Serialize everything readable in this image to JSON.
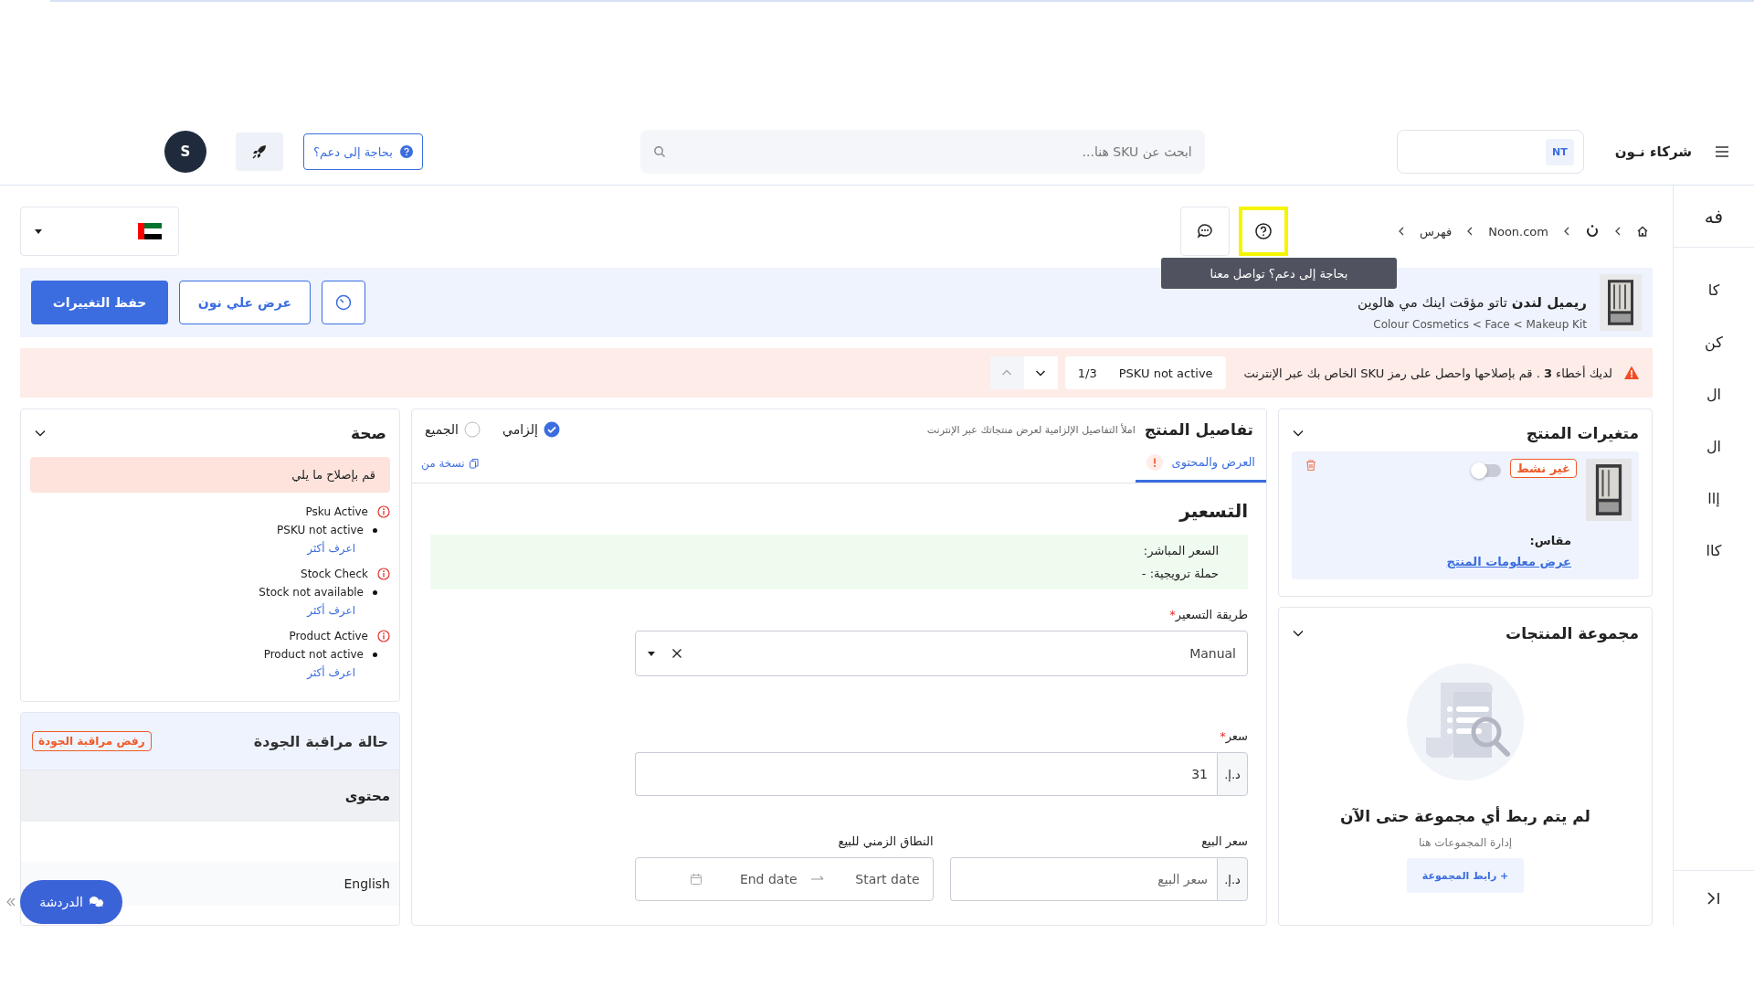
{
  "header": {
    "brand": "شركاء نـون",
    "account_badge": "NT",
    "search": {
      "placeholder": "ابحث عن SKU هنا..."
    },
    "help_button": "بحاجة إلى دعم؟",
    "avatar": "S"
  },
  "side_nav": [
    {
      "label": "فه",
      "kind": "header"
    },
    {
      "label": "كا",
      "kind": "item"
    },
    {
      "label": "كن",
      "kind": "item"
    },
    {
      "label": "ال",
      "kind": "item"
    },
    {
      "label": "ال",
      "kind": "item"
    },
    {
      "label": "إاا",
      "kind": "item"
    },
    {
      "label": "كاا",
      "kind": "item"
    }
  ],
  "breadcrumb": [
    {
      "label": "Noon.com"
    },
    {
      "label": "فهرس"
    }
  ],
  "support_button": {
    "highlighted": true
  },
  "tooltip": "بحاجة إلى دعم؟ تواصل معنا",
  "product": {
    "title": "**ريميل لندن** تاتو مؤقت اينك مي هالوين",
    "category_path": "Colour Cosmetics < Face < Makeup Kit"
  },
  "actions": {
    "save": "حفظ التغييرات",
    "view": "عرض علي نون"
  },
  "errors": {
    "message": "لديك أخطاء **3** . قم بإصلاحها واحصل على رمز SKU الخاص بك عبر الإنترنت",
    "current": "PSKU not active",
    "counter": "1/3",
    "previous_disabled": true
  },
  "variants": {
    "title": "متغيرات المنتج",
    "items": [
      {
        "status": "غير نشط",
        "active": false,
        "size_label": "مقاس:",
        "link": "عرض معلومات المنتج"
      }
    ]
  },
  "group": {
    "title": "مجموعة المنتجات",
    "empty_title": "لم يتم ربط أي مجموعة حتى الآن",
    "empty_hint": "إدارة المجموعات هنا",
    "link_button": "+ رابط المجموعة"
  },
  "details": {
    "title": "تفاصيل المنتج",
    "subtitle": "املأ التفاصيل الإلزامية لعرض منتجاتك عبر الإنترنت",
    "filters": [
      {
        "label": "إلزامي",
        "selected": true
      },
      {
        "label": "الجميع",
        "selected": false
      }
    ],
    "tabs": [
      {
        "label": "العرض والمحتوى",
        "selected": true,
        "has_error": true
      }
    ],
    "copy_link": "نسخة من",
    "section": "التسعير",
    "live_price": "السعر المباشر:",
    "promo": "حملة ترويجية: -",
    "pricing_method": {
      "label": "طريقة التسعير",
      "required_mark": "*",
      "value": "Manual"
    },
    "price": {
      "label": "سعر",
      "required_mark": "*",
      "currency": "د.إ.",
      "value": "31"
    },
    "sale_price": {
      "label": "سعر البيع",
      "currency": "د.إ.",
      "placeholder": "سعر البيع"
    },
    "sale_period": {
      "label": "النطاق الزمني للبيع",
      "start_placeholder": "Start date",
      "end_placeholder": "End date"
    }
  },
  "health": {
    "title": "صحة",
    "notice": "قم بإصلاح ما يلي",
    "checks": [
      {
        "name": "Psku Active",
        "issue": "PSKU not active",
        "link": "اعرف أكثر"
      },
      {
        "name": "Stock Check",
        "issue": "Stock not available",
        "link": "اعرف أكثر"
      },
      {
        "name": "Product Active",
        "issue": "Product not active",
        "link": "اعرف أكثر"
      }
    ]
  },
  "qc": {
    "title": "حالة مراقبة الجودة",
    "status": "رفض مراقبة الجودة",
    "rows": [
      {
        "label": "محتوى",
        "kind": "heading"
      },
      {
        "label": "",
        "kind": "blank"
      },
      {
        "label": "English",
        "kind": "item"
      }
    ]
  },
  "chat_button": "الدردشة"
}
